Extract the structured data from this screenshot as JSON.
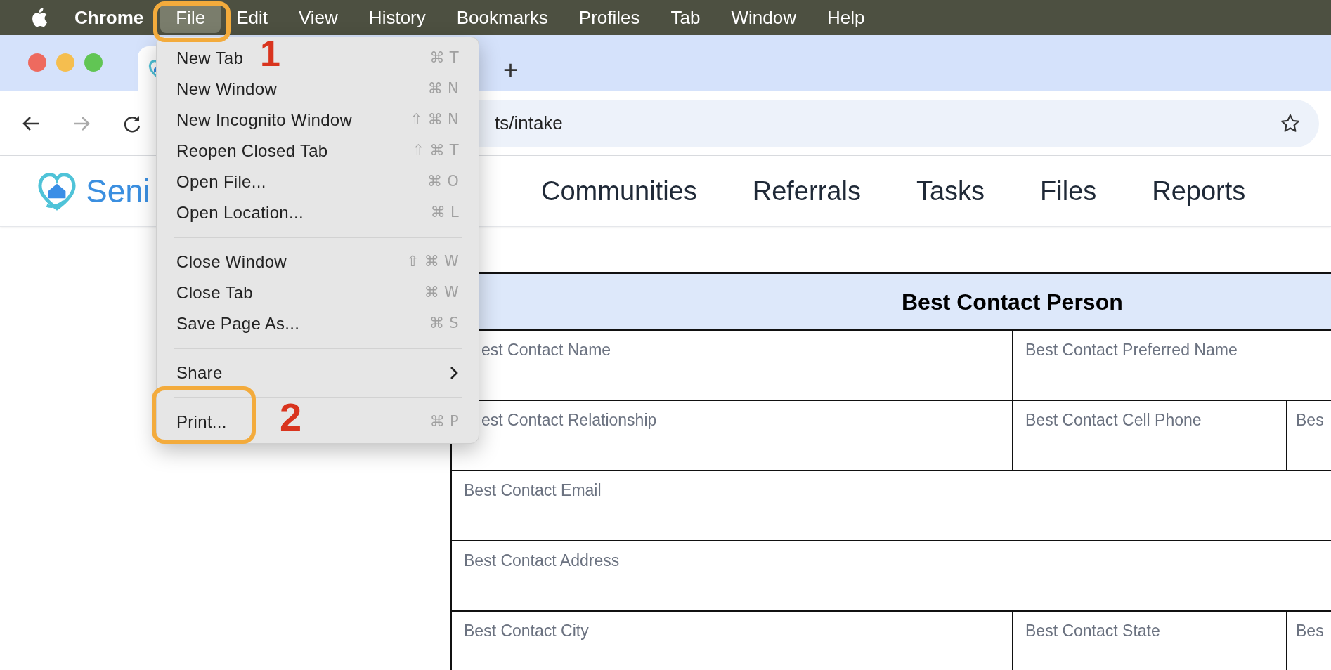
{
  "menu_bar": {
    "app": "Chrome",
    "items": [
      {
        "label": "File",
        "selected": true
      },
      {
        "label": "Edit",
        "selected": false
      },
      {
        "label": "View",
        "selected": false
      },
      {
        "label": "History",
        "selected": false
      },
      {
        "label": "Bookmarks",
        "selected": false
      },
      {
        "label": "Profiles",
        "selected": false
      },
      {
        "label": "Tab",
        "selected": false
      },
      {
        "label": "Window",
        "selected": false
      },
      {
        "label": "Help",
        "selected": false
      }
    ]
  },
  "new_tab_button": "+",
  "address_bar": {
    "value": "ts/intake"
  },
  "site": {
    "logo_text": "Seni",
    "nav": [
      "Communities",
      "Referrals",
      "Tasks",
      "Files",
      "Reports"
    ]
  },
  "form": {
    "title": "Best Contact Person",
    "rows": [
      {
        "cells": [
          "est Contact Name",
          "Best Contact Preferred Name"
        ]
      },
      {
        "cells": [
          "est Contact Relationship",
          "Best Contact Cell Phone",
          "Bes"
        ]
      },
      {
        "cells": [
          "Best Contact Email"
        ]
      },
      {
        "cells": [
          "Best Contact Address"
        ]
      },
      {
        "cells": [
          "Best Contact City",
          "Best Contact State",
          "Bes"
        ]
      }
    ]
  },
  "file_menu": {
    "items": [
      {
        "kind": "item",
        "label": "New Tab",
        "shortcut": "⌘ T"
      },
      {
        "kind": "item",
        "label": "New Window",
        "shortcut": "⌘ N"
      },
      {
        "kind": "item",
        "label": "New Incognito Window",
        "shortcut": "⇧ ⌘ N"
      },
      {
        "kind": "item",
        "label": "Reopen Closed Tab",
        "shortcut": "⇧ ⌘ T"
      },
      {
        "kind": "item",
        "label": "Open File...",
        "shortcut": "⌘ O"
      },
      {
        "kind": "item",
        "label": "Open Location...",
        "shortcut": "⌘ L"
      },
      {
        "kind": "separator"
      },
      {
        "kind": "item",
        "label": "Close Window",
        "shortcut": "⇧ ⌘ W"
      },
      {
        "kind": "item",
        "label": "Close Tab",
        "shortcut": "⌘ W"
      },
      {
        "kind": "item",
        "label": "Save Page As...",
        "shortcut": "⌘ S"
      },
      {
        "kind": "separator"
      },
      {
        "kind": "submenu",
        "label": "Share"
      },
      {
        "kind": "separator"
      },
      {
        "kind": "item",
        "label": "Print...",
        "shortcut": "⌘ P"
      }
    ]
  },
  "annotations": [
    {
      "label": "1"
    },
    {
      "label": "2"
    }
  ]
}
